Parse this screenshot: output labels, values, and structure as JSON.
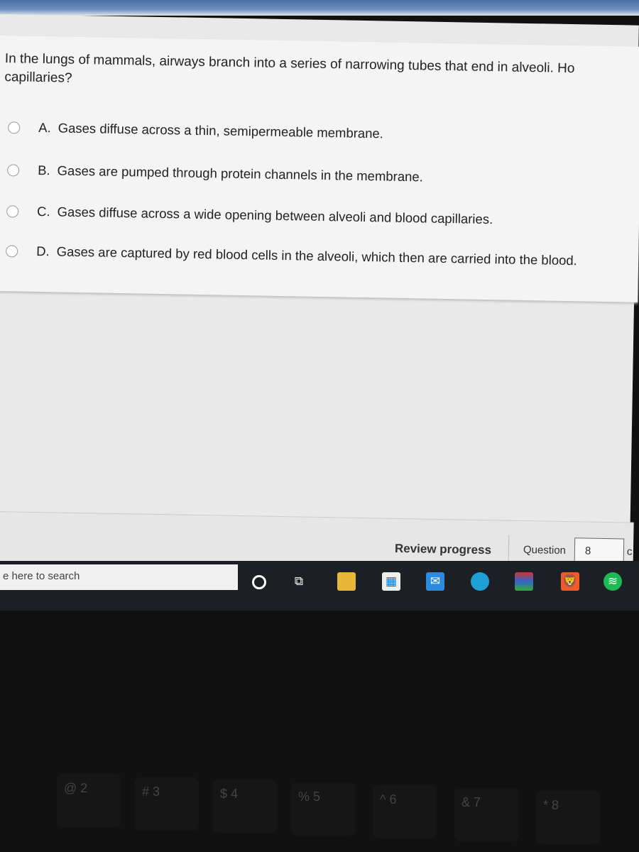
{
  "question": {
    "line1": "In the lungs of mammals, airways branch into a series of narrowing tubes that end in alveoli. Ho",
    "line2": "capillaries?"
  },
  "options": [
    {
      "letter": "A.",
      "text": "Gases diffuse across a thin, semipermeable membrane."
    },
    {
      "letter": "B.",
      "text": "Gases are pumped through protein channels in the membrane."
    },
    {
      "letter": "C.",
      "text": "Gases diffuse across a wide opening between alveoli and blood capillaries."
    },
    {
      "letter": "D.",
      "text": "Gases are captured by red blood cells in the alveoli, which then are carried into the blood."
    }
  ],
  "footer": {
    "review_label": "Review progress",
    "question_label": "Question",
    "question_value": "8",
    "of_label": "c"
  },
  "taskbar": {
    "search_placeholder": "e here to search",
    "icons": [
      "cortana-icon",
      "task-view-icon",
      "file-explorer-icon",
      "store-icon",
      "mail-icon",
      "edge-icon",
      "winrar-icon",
      "brave-icon",
      "spotify-icon"
    ]
  },
  "keyboard": {
    "keys": [
      "@ 2",
      "# 3",
      "$ 4",
      "% 5",
      "^ 6",
      "& 7",
      "* 8"
    ]
  }
}
